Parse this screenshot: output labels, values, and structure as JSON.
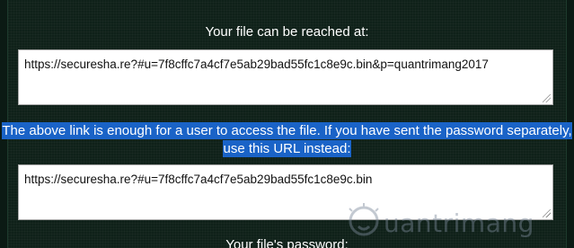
{
  "reach_heading": "Your file can be reached at:",
  "full_url": "https://securesha.re?#u=7f8cffc7a4cf7e5ab29bad55fc1c8e9c.bin&p=quantrimang2017",
  "notice": {
    "line1": "The above link is enough for a user to access the file. If you have sent the password separately,",
    "line2": "use this URL instead:"
  },
  "short_url": "https://securesha.re?#u=7f8cffc7a4cf7e5ab29bad55fc1c8e9c.bin",
  "password_heading": "Your file's password:",
  "watermark": {
    "text": "uantrimang",
    "icon": "lightbulb-logo-icon"
  },
  "colors": {
    "background": "#0f2119",
    "selection": "#1a63c7",
    "text": "#ffffff"
  }
}
